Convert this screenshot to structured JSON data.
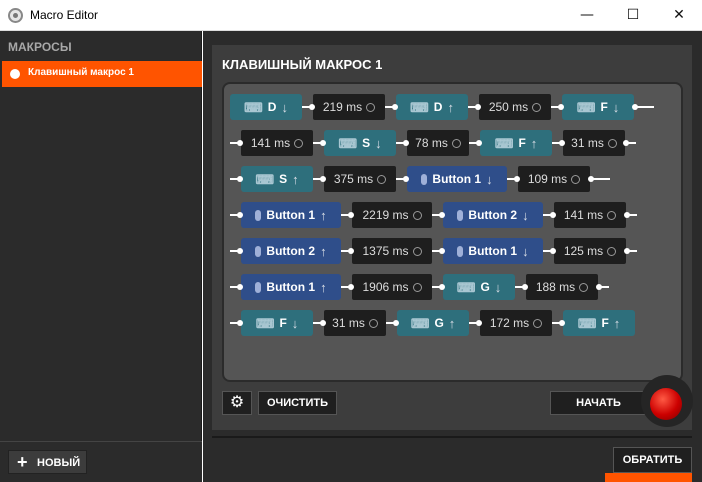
{
  "window": {
    "title": "Macro Editor",
    "minimize_glyph": "—",
    "maximize_glyph": "☐",
    "close_glyph": "✕"
  },
  "sidebar": {
    "header": "МАКРОСЫ",
    "items": [
      {
        "label": "Клавишный макрос 1",
        "selected": true
      }
    ],
    "new_button": {
      "label": "НОВЫЙ",
      "icon": "plus-icon"
    }
  },
  "macro": {
    "title": "КЛАВИШНЫЙ МАКРОС 1",
    "rows": [
      {
        "steps": [
          {
            "kind": "key",
            "device": "keyboard",
            "label": "D",
            "dir": "down"
          },
          {
            "kind": "delay",
            "label": "219 ms"
          },
          {
            "kind": "key",
            "device": "keyboard",
            "label": "D",
            "dir": "up"
          },
          {
            "kind": "delay",
            "label": "250 ms"
          },
          {
            "kind": "key",
            "device": "keyboard",
            "label": "F",
            "dir": "down"
          }
        ]
      },
      {
        "steps": [
          {
            "kind": "delay",
            "label": "141 ms"
          },
          {
            "kind": "key",
            "device": "keyboard",
            "label": "S",
            "dir": "down"
          },
          {
            "kind": "delay",
            "label": "78 ms"
          },
          {
            "kind": "key",
            "device": "keyboard",
            "label": "F",
            "dir": "up"
          },
          {
            "kind": "delay",
            "label": "31 ms"
          }
        ]
      },
      {
        "steps": [
          {
            "kind": "key",
            "device": "keyboard",
            "label": "S",
            "dir": "up"
          },
          {
            "kind": "delay",
            "label": "375 ms"
          },
          {
            "kind": "key",
            "device": "mouse",
            "label": "Button 1",
            "dir": "down"
          },
          {
            "kind": "delay",
            "label": "109 ms"
          }
        ]
      },
      {
        "steps": [
          {
            "kind": "key",
            "device": "mouse",
            "label": "Button 1",
            "dir": "up"
          },
          {
            "kind": "delay",
            "label": "2219 ms"
          },
          {
            "kind": "key",
            "device": "mouse",
            "label": "Button 2",
            "dir": "down"
          },
          {
            "kind": "delay",
            "label": "141 ms"
          }
        ]
      },
      {
        "steps": [
          {
            "kind": "key",
            "device": "mouse",
            "label": "Button 2",
            "dir": "up"
          },
          {
            "kind": "delay",
            "label": "1375 ms"
          },
          {
            "kind": "key",
            "device": "mouse",
            "label": "Button 1",
            "dir": "down"
          },
          {
            "kind": "delay",
            "label": "125 ms"
          }
        ]
      },
      {
        "steps": [
          {
            "kind": "key",
            "device": "mouse",
            "label": "Button 1",
            "dir": "up"
          },
          {
            "kind": "delay",
            "label": "1906 ms"
          },
          {
            "kind": "key",
            "device": "keyboard",
            "label": "G",
            "dir": "down"
          },
          {
            "kind": "delay",
            "label": "188 ms"
          }
        ]
      },
      {
        "steps": [
          {
            "kind": "key",
            "device": "keyboard",
            "label": "F",
            "dir": "down"
          },
          {
            "kind": "delay",
            "label": "31 ms"
          },
          {
            "kind": "key",
            "device": "keyboard",
            "label": "G",
            "dir": "up"
          },
          {
            "kind": "delay",
            "label": "172 ms"
          },
          {
            "kind": "key",
            "device": "keyboard",
            "label": "F",
            "dir": "up"
          }
        ]
      }
    ]
  },
  "controls": {
    "settings_icon": "gear-icon",
    "clear_label": "ОЧИСТИТЬ",
    "start_label": "НАЧАТЬ",
    "record_icon": "record-icon",
    "revert_label": "ОБРАТИТЬ"
  },
  "colors": {
    "accent": "#ff5400",
    "keyboard_key": "#2e6f7c",
    "mouse_key": "#2f4e8a",
    "delay": "#1e1e1e",
    "record": "#cc0000"
  }
}
